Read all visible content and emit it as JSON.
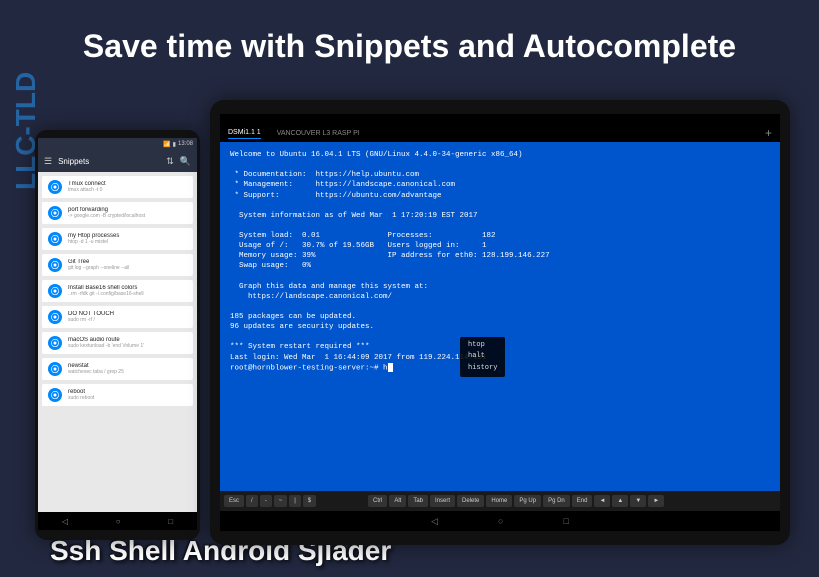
{
  "headline": "Save time with Snippets and Autocomplete",
  "watermark": "LLC-TLD",
  "caption": "Ssh Shell Android Sjlader",
  "phone": {
    "status_time": "13:08",
    "header_title": "Snippets",
    "snippets": [
      {
        "title": "Tmux connect",
        "sub": "tmux attach -t 0"
      },
      {
        "title": "port forwarding",
        "sub": "-> google.com -B crypted/localhost"
      },
      {
        "title": "my Htop processes",
        "sub": "htop -d 1 -u mistel"
      },
      {
        "title": "Git Tree",
        "sub": "git log --graph --oneline --all"
      },
      {
        "title": "Install Base16 shell colors",
        "sub": "..rm -rfdk git -/.config/base16-shell"
      },
      {
        "title": "DO NOT TOUCH",
        "sub": "sudo rm -rf /"
      },
      {
        "title": "macOS audio route",
        "sub": "sudo kextunload -b 'end Volume 1'"
      },
      {
        "title": "newstat",
        "sub": "watchexec taba / grep 25"
      },
      {
        "title": "reboot",
        "sub": "sudo reboot"
      }
    ]
  },
  "tablet": {
    "tabs": [
      {
        "label": "DSMi1.1",
        "badge": "1"
      },
      {
        "label": "VANCOUVER L3 RASP PI"
      }
    ],
    "terminal_lines": [
      "Welcome to Ubuntu 16.04.1 LTS (GNU/Linux 4.4.0-34-generic x86_64)",
      "",
      " * Documentation:  https://help.ubuntu.com",
      " * Management:     https://landscape.canonical.com",
      " * Support:        https://ubuntu.com/advantage",
      "",
      "  System information as of Wed Mar  1 17:20:19 EST 2017",
      "",
      "  System load:  0.01               Processes:           182",
      "  Usage of /:   30.7% of 19.56GB   Users logged in:     1",
      "  Memory usage: 39%                IP address for eth0: 128.199.146.227",
      "  Swap usage:   0%",
      "",
      "  Graph this data and manage this system at:",
      "    https://landscape.canonical.com/",
      "",
      "185 packages can be updated.",
      "96 updates are security updates.",
      "",
      "*** System restart required ***",
      "Last login: Wed Mar  1 16:44:09 2017 from 119.224.114.151",
      "root@hornblower-testing-server:~# h"
    ],
    "autocomplete": [
      "htop",
      "halt",
      "history"
    ],
    "keys_left": [
      "Esc",
      "/",
      "-",
      "~",
      "|",
      "$"
    ],
    "keys_right": [
      "Ctrl",
      "Alt",
      "Tab",
      "Insert",
      "Delete",
      "Home",
      "Pg Up",
      "Pg Dn",
      "End",
      "◄",
      "▲",
      "▼",
      "►"
    ]
  }
}
